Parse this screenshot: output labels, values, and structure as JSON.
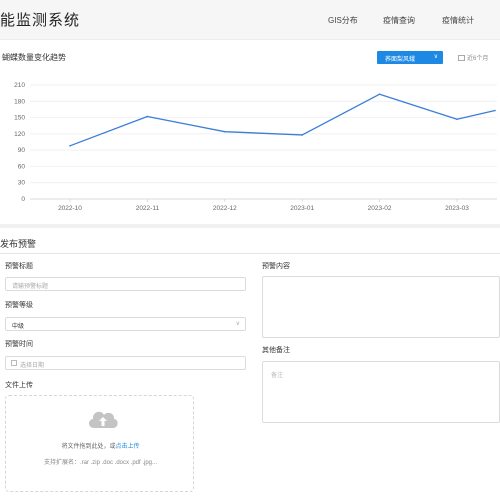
{
  "header": {
    "title": "能监测系统",
    "nav": [
      "GIS分布",
      "疫情查询",
      "疫情统计"
    ]
  },
  "chart_panel": {
    "title": "蝴蝶数量变化趋势",
    "select_value": "荞面梨风蛾",
    "range_label": "近6个月"
  },
  "chart_data": {
    "type": "line",
    "title": "",
    "xlabel": "",
    "ylabel": "",
    "categories": [
      "2022-10",
      "2022-11",
      "2022-12",
      "2023-01",
      "2023-02",
      "2023-03"
    ],
    "series": [
      {
        "name": "",
        "x": [
          "2022-10",
          "2022-11",
          "2022-12",
          "2023-01",
          "2023-02",
          "2023-03",
          "2023-04"
        ],
        "values": [
          98,
          152,
          124,
          118,
          193,
          147,
          163
        ]
      }
    ],
    "ylim": [
      0,
      210
    ],
    "yticks": [
      0,
      30,
      60,
      90,
      120,
      150,
      180,
      210
    ],
    "grid": true,
    "color": "#3b7dd8"
  },
  "form": {
    "section_title": "发布预警",
    "warning_title_label": "预警标题",
    "warning_title_placeholder": "请输预警标题",
    "warning_level_label": "预警等级",
    "warning_level_value": "中级",
    "warning_time_label": "预警时间",
    "warning_time_placeholder": "选择日期",
    "file_upload_label": "文件上传",
    "upload_text": "将文件拖到此处，或",
    "upload_link": "点击上传",
    "upload_tip": "支持扩展名：.rar .zip .doc .docx .pdf .jpg...",
    "content_label": "预警内容",
    "remark_label": "其他备注",
    "remark_placeholder": "备注"
  }
}
